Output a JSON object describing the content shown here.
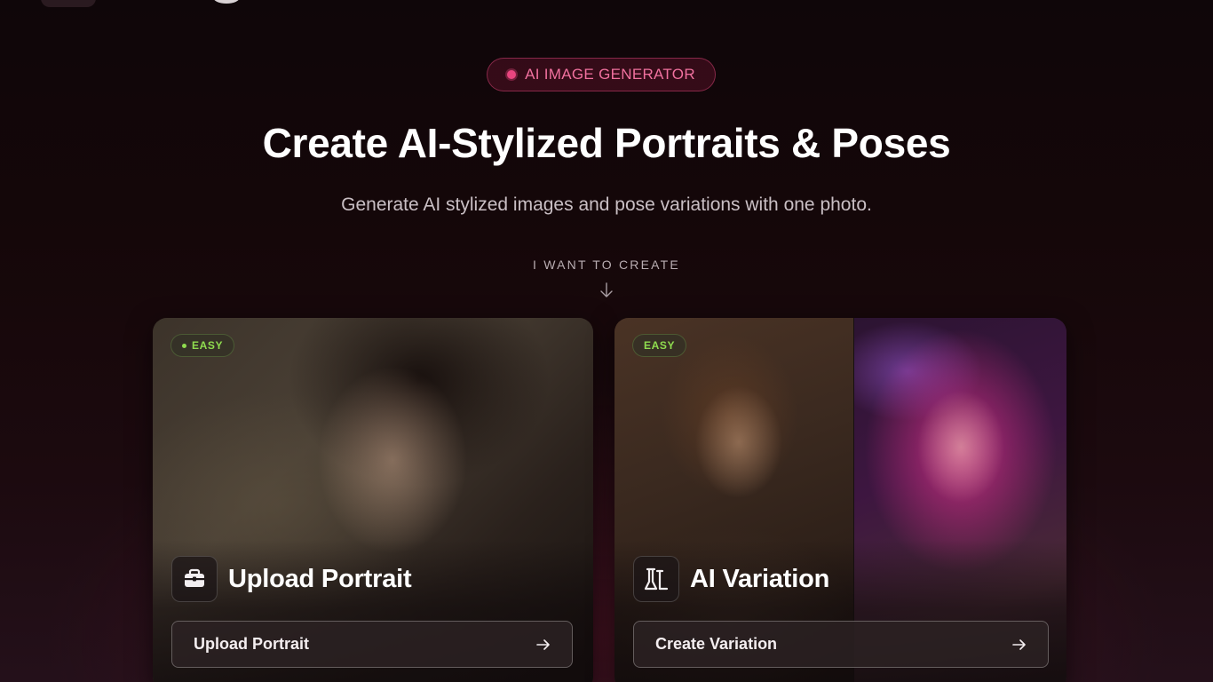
{
  "hero": {
    "badge": "AI IMAGE GENERATOR",
    "title": "Create AI-Stylized Portraits & Poses",
    "subtitle": "Generate AI stylized images and pose variations with one photo.",
    "create_prompt": "I WANT TO CREATE"
  },
  "cards": [
    {
      "tag": "EASY",
      "title": "Upload Portrait",
      "icon": "portrait-upload-icon",
      "button_label": "Upload Portrait"
    },
    {
      "tag": "EASY",
      "title": "AI Variation",
      "icon": "variation-flask-icon",
      "button_label": "Create Variation"
    }
  ],
  "colors": {
    "accent_pink": "#e9457f",
    "easy_green": "#8fdc4f",
    "background": "#150709"
  }
}
